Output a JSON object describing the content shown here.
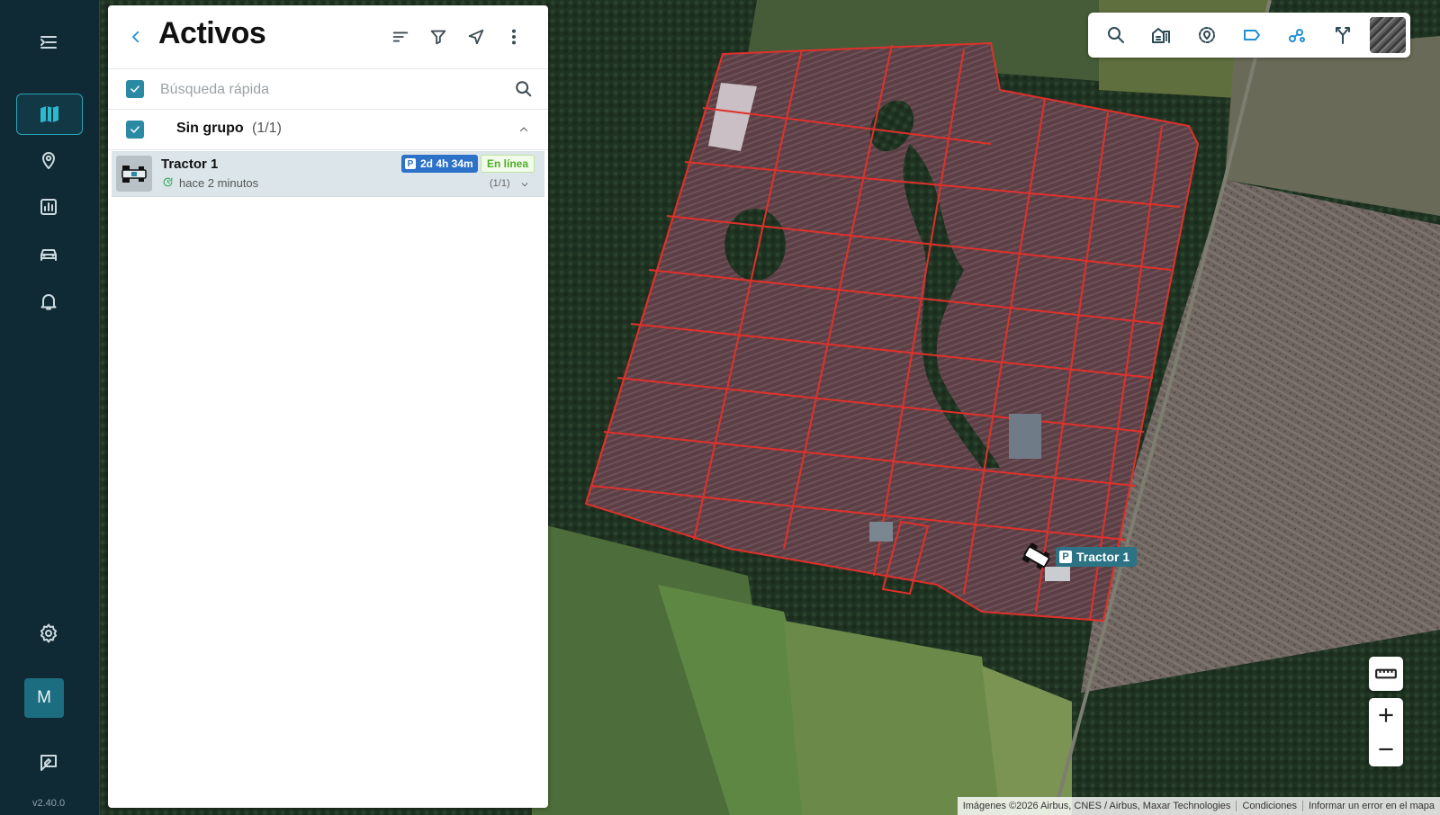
{
  "rail": {
    "items": [
      {
        "name": "collapse-menu",
        "icon": "menu-collapse-icon"
      },
      {
        "name": "map",
        "icon": "map-icon",
        "active": true
      },
      {
        "name": "places",
        "icon": "location-pin-icon"
      },
      {
        "name": "reports",
        "icon": "bar-chart-icon"
      },
      {
        "name": "vehicles",
        "icon": "car-icon"
      },
      {
        "name": "alerts",
        "icon": "bell-icon"
      },
      {
        "name": "settings",
        "icon": "gear-icon"
      },
      {
        "name": "feedback",
        "icon": "feedback-icon"
      }
    ],
    "avatar_initial": "M",
    "version": "v2.40.0"
  },
  "panel": {
    "title": "Activos",
    "header_actions": [
      "sort-icon",
      "filter-icon",
      "navigate-icon",
      "more-vertical-icon"
    ],
    "search": {
      "placeholder": "Búsqueda rápida",
      "value": ""
    },
    "group": {
      "name": "Sin grupo",
      "count": "(1/1)"
    },
    "assets": [
      {
        "name": "Tractor 1",
        "last_update": "hace 2 minutos",
        "parked_duration": "2d 4h 34m",
        "status": "En línea",
        "sub_count": "(1/1)"
      }
    ]
  },
  "map": {
    "toolbar": [
      "search-icon",
      "buildings-icon",
      "geofence-pin-icon",
      "label-tag-icon",
      "clusters-icon",
      "route-fork-icon",
      "satellite-layer-icon"
    ],
    "marker_label": "Tractor 1",
    "attribution": [
      "Imágenes ©2026 Airbus, CNES / Airbus, Maxar Technologies",
      "Condiciones",
      "Informar un error en el mapa"
    ],
    "colors": {
      "field_outline": "#e0302a",
      "accent": "#2b8aa3"
    }
  }
}
